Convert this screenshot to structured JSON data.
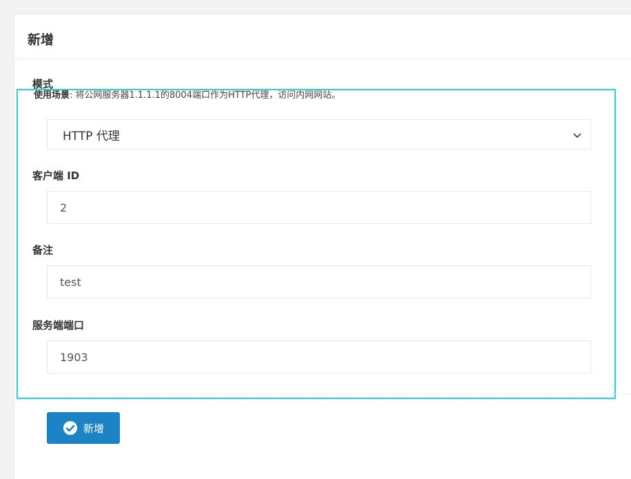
{
  "form": {
    "title": "新增",
    "mode": {
      "label": "模式",
      "hint_label": "使用场景",
      "hint_text": ": 将公网服务器1.1.1.1的8004端口作为HTTP代理，访问内网网站。",
      "selected": "HTTP 代理",
      "icon": "chevron-down-icon"
    },
    "client_id": {
      "label": "客户端 ID",
      "value": "2"
    },
    "remark": {
      "label": "备注",
      "value": "test"
    },
    "server_port": {
      "label": "服务端端口",
      "value": "1903"
    },
    "submit": {
      "label": "新增",
      "icon": "check-circle-icon"
    }
  },
  "colors": {
    "primary": "#1c84c6",
    "highlight": "#23d3df",
    "background": "#f3f3f4"
  }
}
